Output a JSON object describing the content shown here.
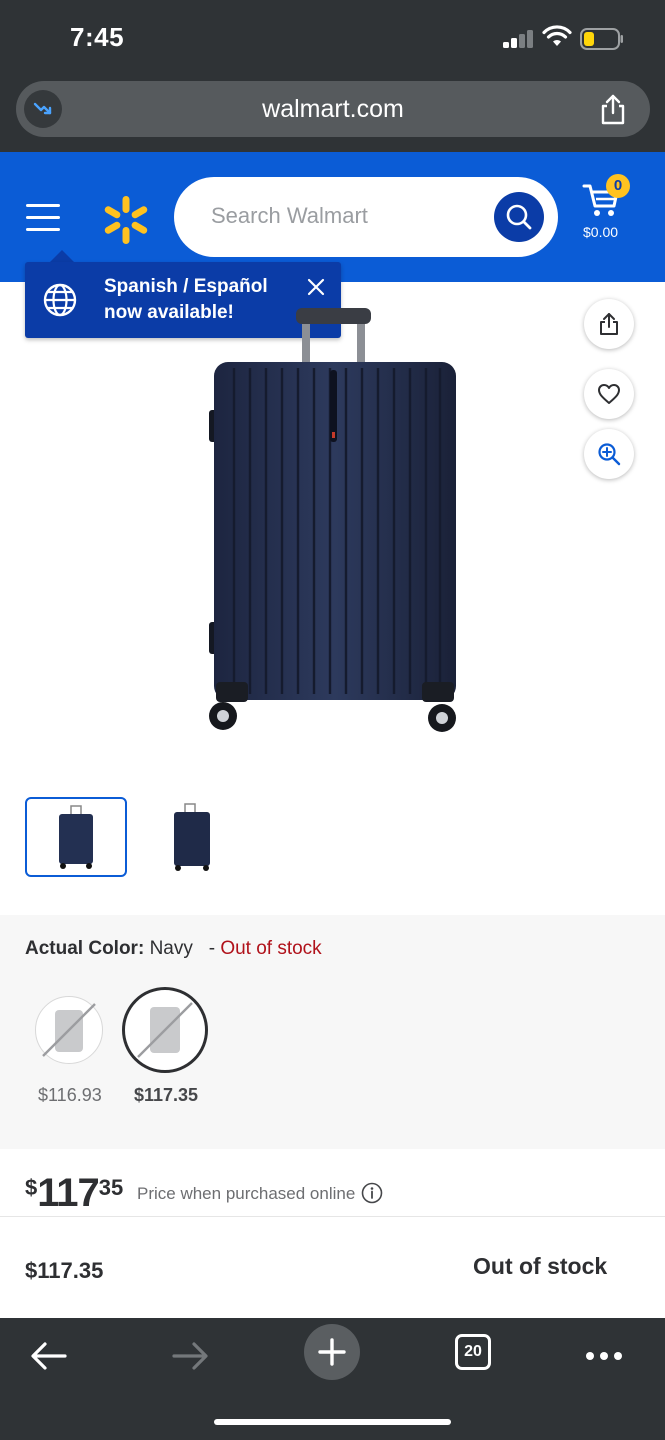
{
  "status_bar": {
    "time": "7:45"
  },
  "browser": {
    "url": "walmart.com",
    "open_tabs": "20"
  },
  "header": {
    "search_placeholder": "Search Walmart",
    "cart_count": "0",
    "cart_total": "$0.00",
    "brand_color": "#0b5cd6",
    "spark_color": "#ffc220"
  },
  "language_popup": {
    "line1": "Spanish / Español",
    "line2": "now available!"
  },
  "product": {
    "image_icon": "navy-suitcase",
    "thumbnail_count": 2,
    "actual_color_label": "Actual Color:",
    "actual_color_value": "Navy",
    "color_dash": "-",
    "color_status": "Out of stock",
    "variants": [
      {
        "price": "$116.93",
        "selected": false,
        "unavailable": true
      },
      {
        "price": "$117.35",
        "selected": true,
        "unavailable": true
      }
    ],
    "price_currency": "$",
    "price_dollars": "117",
    "price_cents": "35",
    "price_note": "Price when purchased online",
    "sticky_price": "$117.35",
    "availability": "Out of stock"
  },
  "icons": {
    "trend": "trend-down-icon",
    "share": "share-icon",
    "heart": "heart-icon",
    "zoom": "zoom-in-icon",
    "info": "info-icon",
    "globe": "globe-icon",
    "close": "close-icon"
  }
}
